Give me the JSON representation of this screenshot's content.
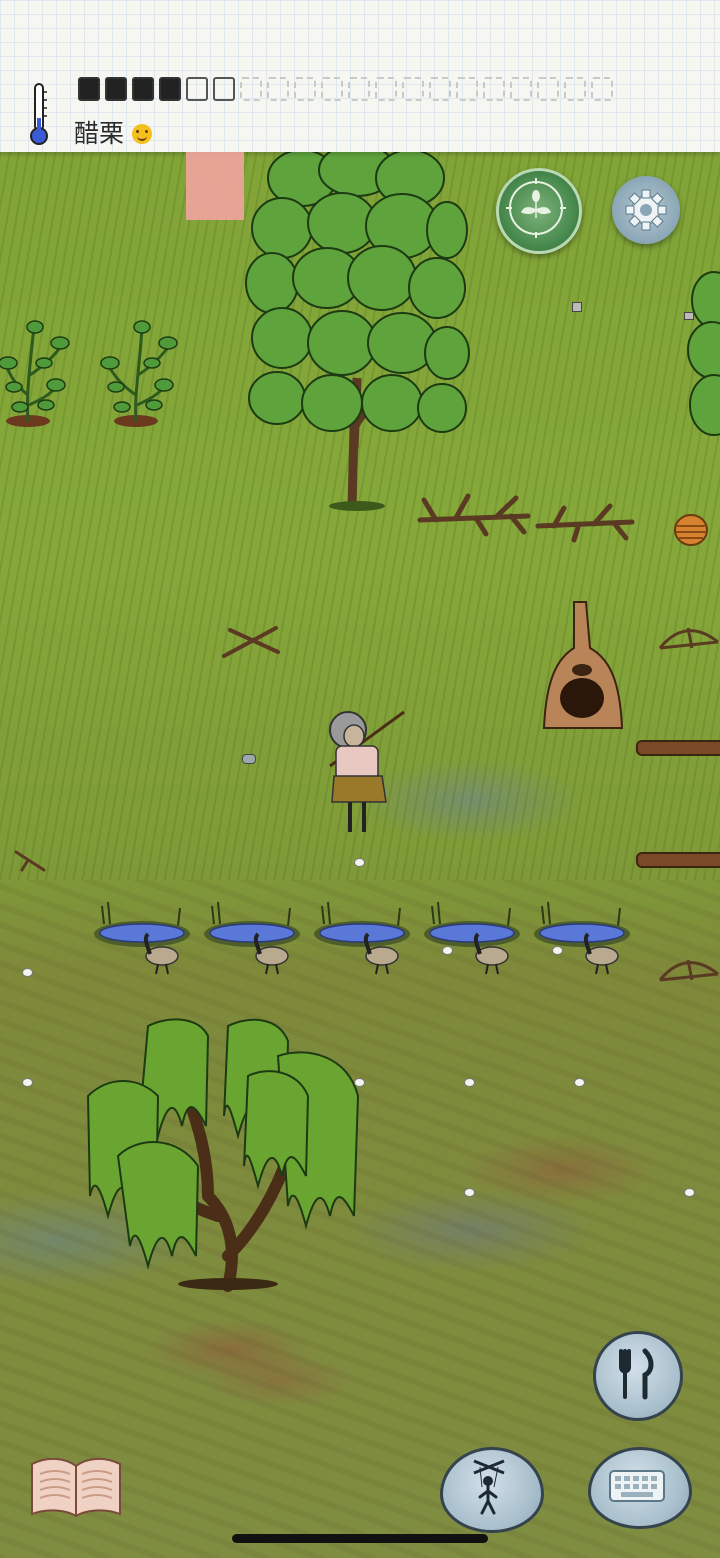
{
  "hud": {
    "food_label": "醋栗",
    "food_emoji_icon": "smiling-face-icon",
    "food_pips": [
      "filled",
      "filled",
      "filled",
      "filled",
      "empty",
      "empty",
      "ghost",
      "ghost",
      "ghost",
      "ghost",
      "ghost",
      "ghost",
      "ghost",
      "ghost",
      "ghost",
      "ghost",
      "ghost",
      "ghost",
      "ghost",
      "ghost"
    ]
  },
  "buttons": {
    "compass": "compass-icon",
    "settings": "gear-icon",
    "eat": "fork-knife-icon",
    "puppet": "puppet-icon",
    "keyboard": "keyboard-icon",
    "book": "book-icon"
  },
  "scene": {
    "objects": [
      "gooseberry-bush",
      "gooseberry-bush",
      "maple-tree",
      "maple-tree-partial",
      "branch",
      "branch",
      "basket",
      "kindling-sticks",
      "adobe-kiln",
      "bow-drill",
      "log",
      "log",
      "bow-drill",
      "player-character",
      "pond-with-goose",
      "pond-with-goose",
      "pond-with-goose",
      "pond-with-goose",
      "pond-with-goose",
      "willow-tree"
    ]
  },
  "colors": {
    "grass": "#86a83a",
    "swamp": "#7f8d40",
    "paper": "#f7f7f2",
    "note": "#f1a4a0"
  }
}
